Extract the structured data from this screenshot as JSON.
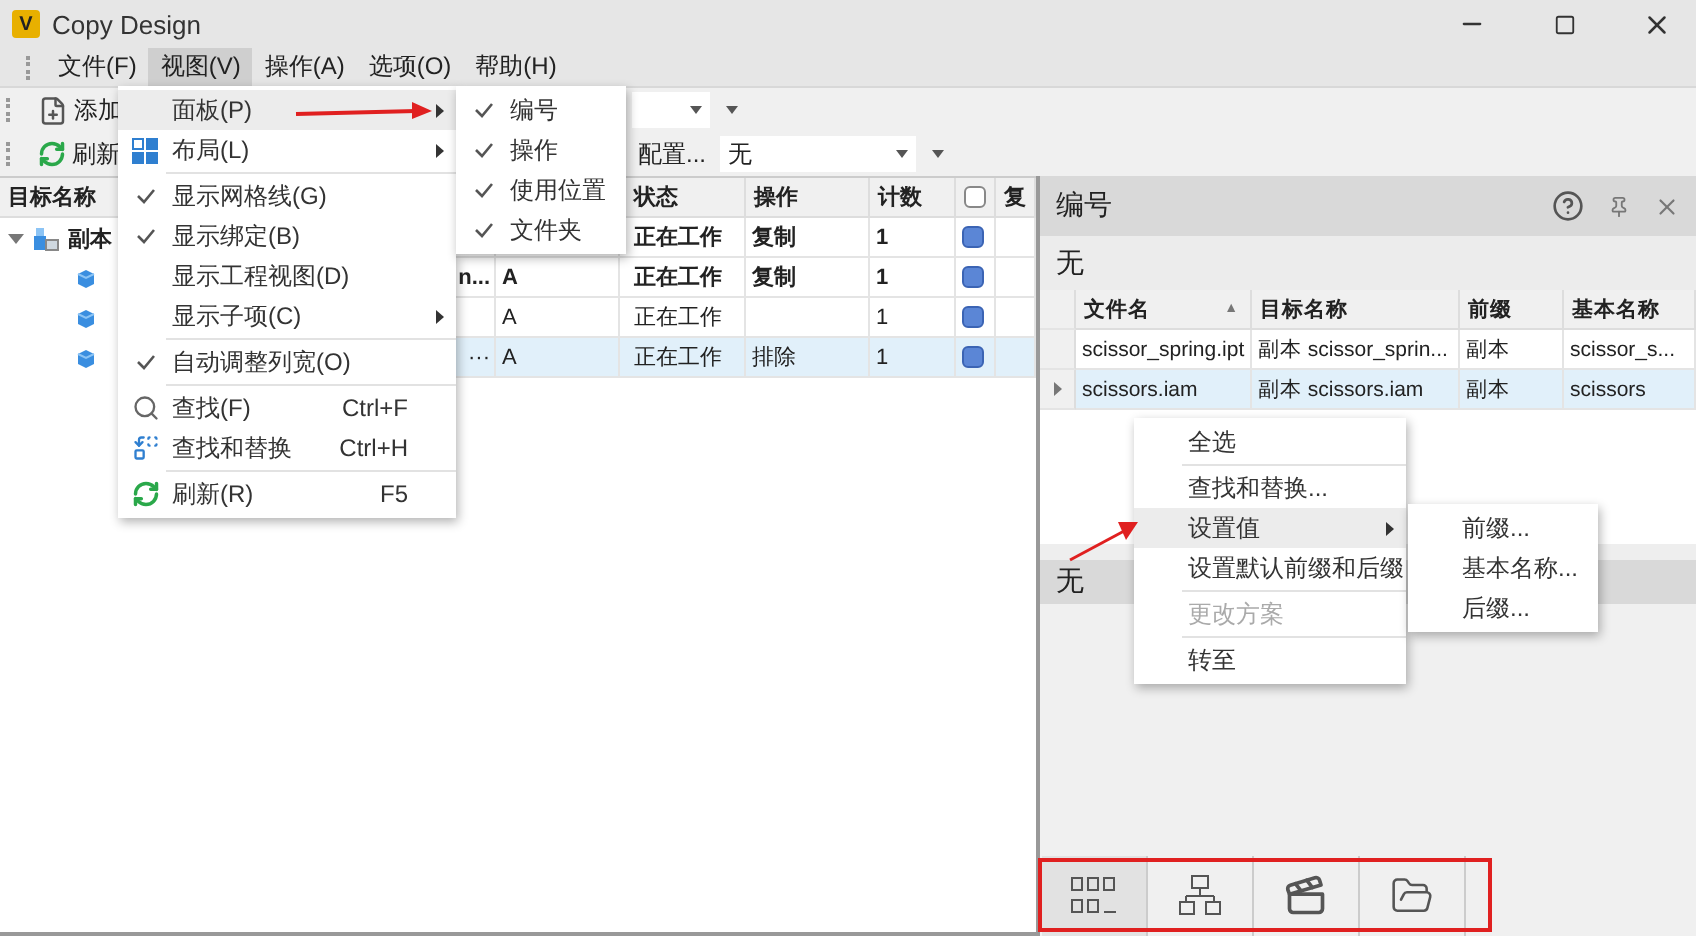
{
  "window": {
    "logo": "V",
    "title": "Copy Design"
  },
  "menubar": [
    {
      "label": "文件(F)",
      "selected": false
    },
    {
      "label": "视图(V)",
      "selected": true
    },
    {
      "label": "操作(A)",
      "selected": false
    },
    {
      "label": "选项(O)",
      "selected": false
    },
    {
      "label": "帮助(H)",
      "selected": false
    }
  ],
  "toolbar": {
    "add_button": "添加",
    "refresh_button": "刷新",
    "config_button": "配置...",
    "scheme_dropdown": "无"
  },
  "grid": {
    "columns": {
      "name": "目标名称",
      "status": "状态",
      "operation": "操作",
      "count": "计数",
      "column_8": "复"
    },
    "select_all_checked": false,
    "rows": [
      {
        "kind": "assembly",
        "expanded": true,
        "name": "副本",
        "status": "正在工作",
        "operation": "复制",
        "count": "1",
        "checked": true,
        "bold": true,
        "selected": false
      },
      {
        "kind": "part",
        "column_2": "n...",
        "revision": "A",
        "status": "正在工作",
        "operation": "复制",
        "count": "1",
        "checked": true,
        "bold": true,
        "selected": false
      },
      {
        "kind": "part",
        "revision": "A",
        "status": "正在工作",
        "count": "1",
        "checked": true,
        "bold": false,
        "selected": false
      },
      {
        "kind": "part",
        "column_2": "···",
        "revision": "A",
        "status": "正在工作",
        "operation": "排除",
        "count": "1",
        "checked": true,
        "bold": false,
        "selected": true
      }
    ]
  },
  "view_menu": [
    {
      "kind": "submenu",
      "label": "面板(P)",
      "selected": true
    },
    {
      "kind": "layout-submenu",
      "label": "布局(L)",
      "selected": false
    },
    {
      "kind": "separator"
    },
    {
      "kind": "toggle",
      "label": "显示网格线(G)",
      "checked": true,
      "selected": false
    },
    {
      "kind": "toggle",
      "label": "显示绑定(B)",
      "checked": true,
      "selected": false
    },
    {
      "kind": "toggle",
      "label": "显示工程视图(D)",
      "checked": false,
      "selected": false
    },
    {
      "kind": "submenu",
      "label": "显示子项(C)",
      "selected": false
    },
    {
      "kind": "separator"
    },
    {
      "kind": "toggle",
      "label": "自动调整列宽(O)",
      "checked": true,
      "selected": false
    },
    {
      "kind": "separator"
    },
    {
      "kind": "find",
      "label": "查找(F)",
      "shortcut": "Ctrl+F",
      "selected": false
    },
    {
      "kind": "replace",
      "label": "查找和替换",
      "shortcut": "Ctrl+H",
      "selected": false
    },
    {
      "kind": "separator"
    },
    {
      "kind": "refresh",
      "label": "刷新(R)",
      "shortcut": "F5",
      "selected": false
    }
  ],
  "panel_submenu": [
    {
      "label": "编号",
      "checked": true
    },
    {
      "label": "操作",
      "checked": true
    },
    {
      "label": "使用位置",
      "checked": true
    },
    {
      "label": "文件夹",
      "checked": true
    }
  ],
  "right_panel": {
    "title": "编号",
    "scheme": "无",
    "columns": [
      {
        "label": "文件名",
        "sort_indicator": "▲"
      },
      {
        "label": "目标名称"
      },
      {
        "label": "前缀"
      },
      {
        "label": "基本名称"
      }
    ],
    "rows": [
      {
        "file_name": "scissor_spring.ipt",
        "target_name": "副本 scissor_sprin...",
        "prefix": "副本",
        "base_name": "scissor_s...",
        "selected": false
      },
      {
        "file_name": "scissors.iam",
        "target_name": "副本 scissors.iam",
        "prefix": "副本",
        "base_name": "scissors",
        "selected": true
      }
    ],
    "context_menu": [
      {
        "kind": "item",
        "label": "全选",
        "selected": false,
        "disabled": false
      },
      {
        "kind": "separator"
      },
      {
        "kind": "item",
        "label": "查找和替换...",
        "selected": false,
        "disabled": false
      },
      {
        "kind": "submenu",
        "label": "设置值",
        "selected": true,
        "disabled": false
      },
      {
        "kind": "item",
        "label": "设置默认前缀和后缀",
        "selected": false,
        "disabled": false
      },
      {
        "kind": "separator"
      },
      {
        "kind": "item",
        "label": "更改方案",
        "selected": false,
        "disabled": true
      },
      {
        "kind": "separator"
      },
      {
        "kind": "item",
        "label": "转至",
        "selected": false,
        "disabled": false
      }
    ],
    "value_submenu": [
      {
        "label": "前缀...",
        "selected": false
      },
      {
        "label": "基本名称...",
        "selected": false
      },
      {
        "label": "后缀...",
        "selected": false
      }
    ],
    "lower_scheme": "无",
    "bottom_tabs": [
      {
        "kind": "grid",
        "selected": true
      },
      {
        "kind": "hierarchy",
        "selected": false
      },
      {
        "kind": "clapperboard",
        "selected": false
      },
      {
        "kind": "folder",
        "selected": false
      }
    ]
  }
}
